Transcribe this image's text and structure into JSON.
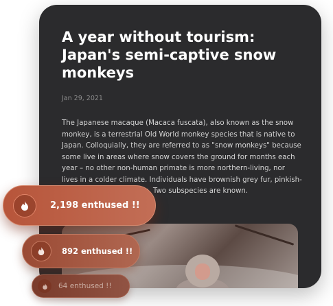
{
  "article": {
    "title": "A year without tourism: Japan's semi-captive snow monkeys",
    "date": "Jan 29, 2021",
    "body": "The Japanese macaque (Macaca fuscata), also known as the snow monkey, is a terrestrial Old World monkey species that is native to Japan. Colloquially, they are referred to as \"snow monkeys\" because some live in areas where snow covers the ground for months each year – no other non-human primate is more northern-living, nor lives in a colder climate. Individuals have brownish grey fur, pinkish-red faces, and short tails. Two subspecies are known."
  },
  "reactions": [
    {
      "label": "2,198 enthused !!",
      "icon": "flame-icon"
    },
    {
      "label": "892 enthused !!",
      "icon": "flame-icon"
    },
    {
      "label": "64 enthused !!",
      "icon": "flame-icon"
    }
  ],
  "colors": {
    "card_bg": "#2b2b2d",
    "accent": "#b7553a"
  }
}
